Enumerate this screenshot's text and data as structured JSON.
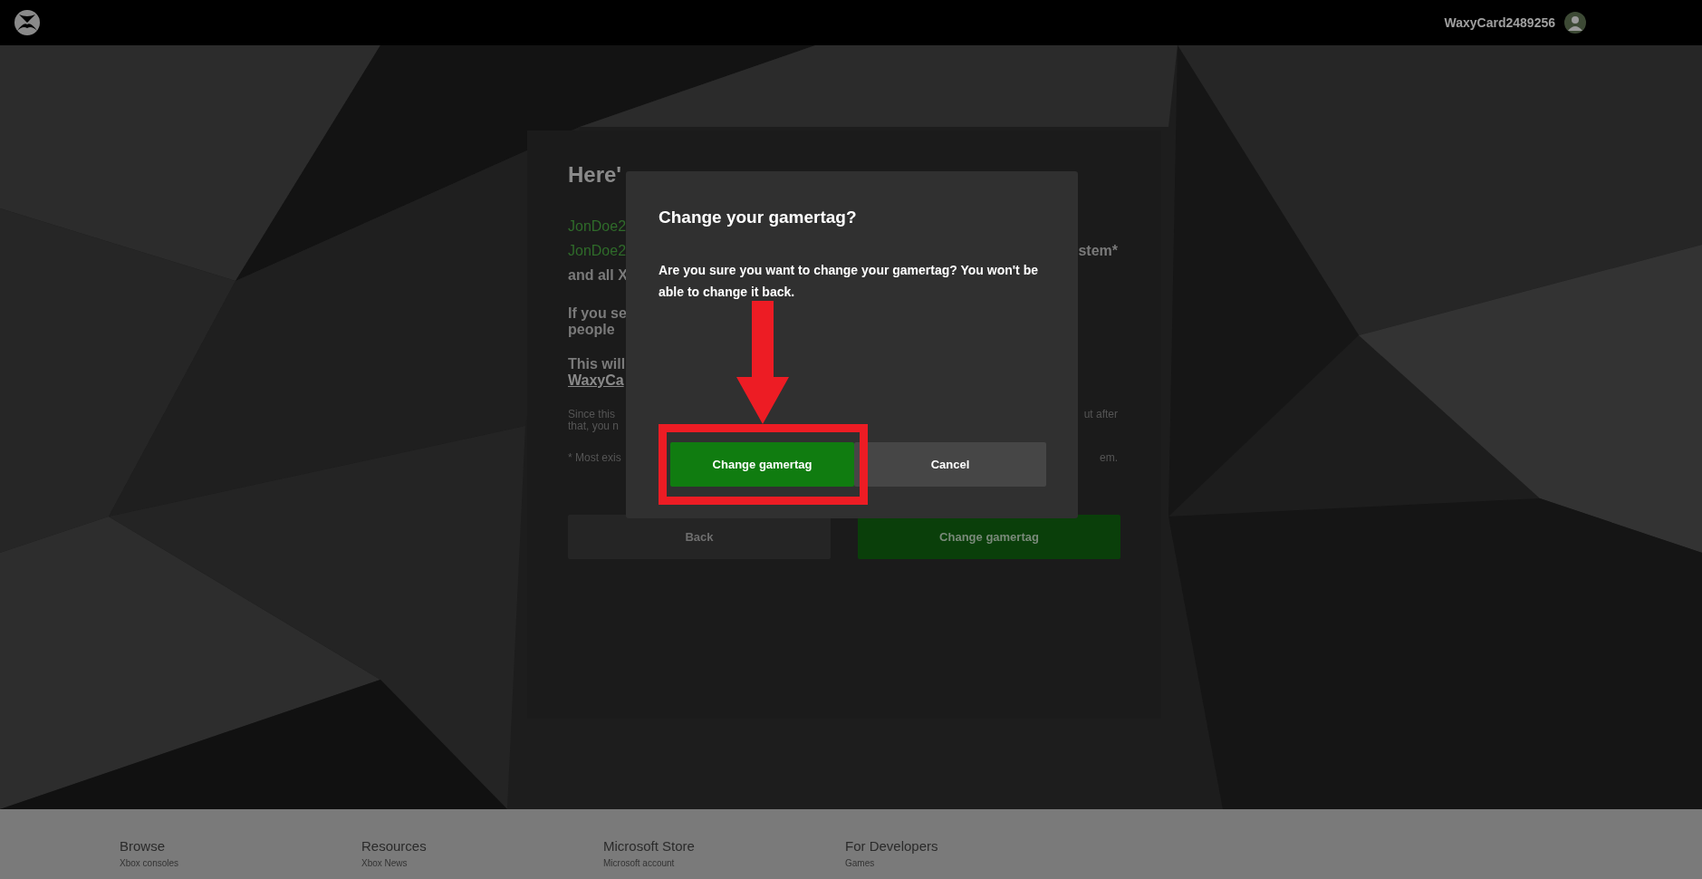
{
  "header": {
    "username": "WaxyCard2489256"
  },
  "card": {
    "paragraphs": [
      {
        "kind": "title",
        "lines": [
          {
            "left": "Here'"
          }
        ]
      },
      {
        "kind": "gamertags",
        "lines": [
          {
            "left": "JonDoe2",
            "kind": "gamertag"
          },
          {
            "left": "JonDoe2",
            "right": "stem*",
            "kind": "gamertag"
          },
          {
            "left": "and all X",
            "kind": "plain"
          }
        ]
      },
      {
        "kind": "body",
        "lines": [
          {
            "left": "If you se"
          },
          {
            "left": "people"
          }
        ]
      },
      {
        "kind": "body",
        "lines": [
          {
            "left": "This will"
          },
          {
            "left": "WaxyCa",
            "kind": "link"
          }
        ]
      },
      {
        "kind": "note",
        "lines": [
          {
            "left": "Since this",
            "right": "ut after"
          },
          {
            "left": "that, you n"
          }
        ]
      },
      {
        "kind": "note",
        "lines": [
          {
            "left": "* Most exis",
            "right": "em."
          }
        ]
      }
    ],
    "buttons": [
      {
        "label": "Back",
        "kind": "secondary"
      },
      {
        "label": "Change gamertag",
        "kind": "primary"
      }
    ]
  },
  "dialog": {
    "title": "Change your gamertag?",
    "message": "Are you sure you want to change your gamertag? You won't be able to change it back.",
    "buttons": [
      {
        "label": "Change gamertag",
        "kind": "primary",
        "highlighted": true
      },
      {
        "label": "Cancel",
        "kind": "secondary",
        "highlighted": false
      }
    ]
  },
  "footer": {
    "columns": [
      {
        "heading": "Browse",
        "link": "Xbox consoles"
      },
      {
        "heading": "Resources",
        "link": "Xbox News"
      },
      {
        "heading": "Microsoft Store",
        "link": "Microsoft account"
      },
      {
        "heading": "For Developers",
        "link": "Games"
      }
    ]
  }
}
